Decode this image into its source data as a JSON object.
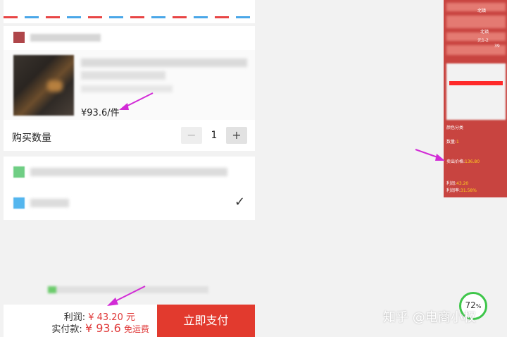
{
  "product": {
    "price_text": "¥93.6/件"
  },
  "quantity": {
    "label": "购买数量",
    "minus": "−",
    "value": "1",
    "plus": "+"
  },
  "payment": {
    "selected_mark": "✓"
  },
  "summary": {
    "profit_label": "利润:",
    "profit_value": "¥ 43.20 元",
    "actual_label": "实付款:",
    "actual_value": "¥ 93.6",
    "shipping": "免运费",
    "pay_button": "立即支付"
  },
  "side_panel": {
    "line_right1": "北镇",
    "line_right2": "元1-2",
    "line_right3": "39",
    "color_label": "颜色分类",
    "qty_label": "数量:",
    "qty_value": "1",
    "sell_price_label": "卖出价格:",
    "sell_price_value": "136.80",
    "profit_label": "利润:",
    "profit_value": "43.20",
    "margin_label": "利润率:",
    "margin_value": "31.58%"
  },
  "watermark": "知乎 @电商小权",
  "progress_badge": {
    "value": "72",
    "unit": "%",
    "fraction": 0.72
  },
  "colors": {
    "accent_red": "#e23a2e",
    "price_red": "#e03a3a",
    "panel_red": "#c84440",
    "arrow_magenta": "#d22bd6",
    "badge_green": "#3ec64a"
  }
}
